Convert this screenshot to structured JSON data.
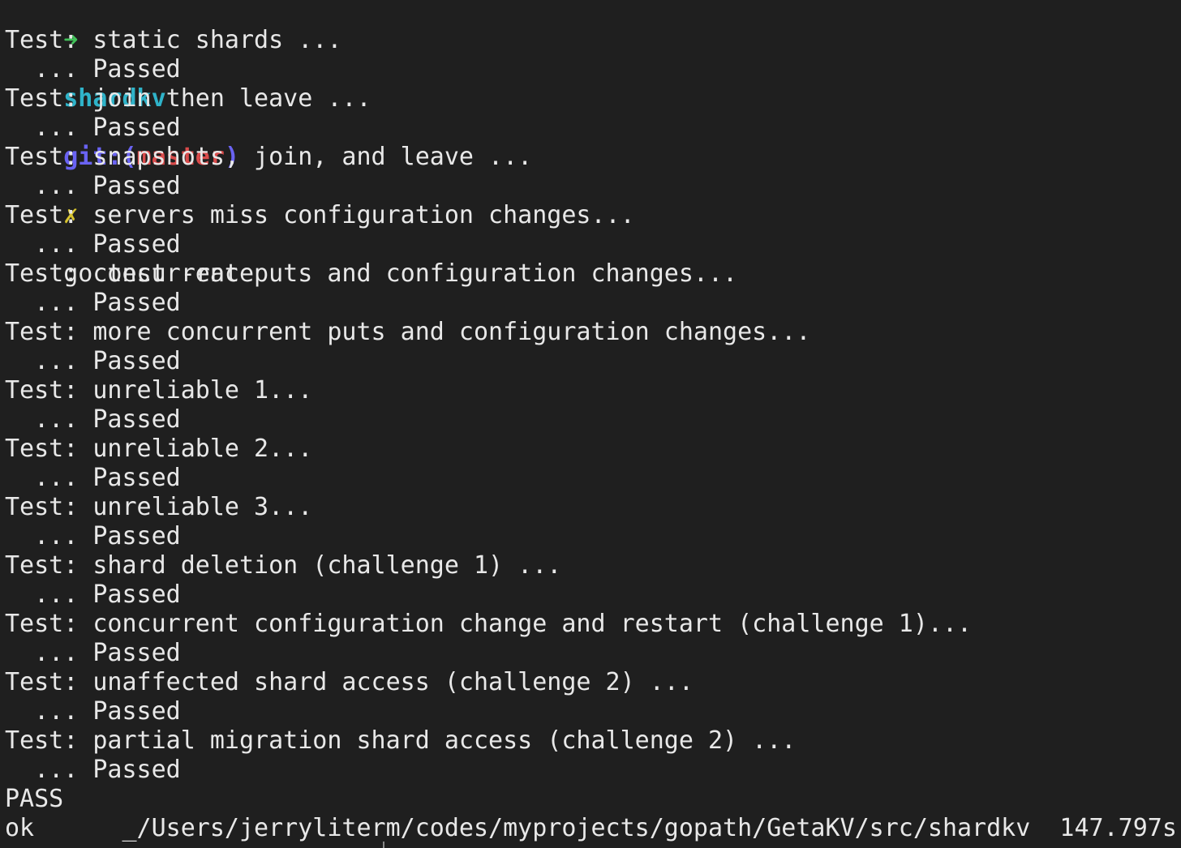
{
  "colors": {
    "background": "#1f1f1f",
    "text": "#e8e8e8",
    "prompt_arrow": "#42c25a",
    "prompt_dir": "#2fb3c9",
    "prompt_git": "#6a63f2",
    "prompt_branch": "#d94b4b",
    "prompt_dirty": "#d8c42f"
  },
  "prompt": {
    "arrow": "➜",
    "directory": "shardkv",
    "git_prefix": "git:(",
    "branch": "master",
    "git_suffix": ")",
    "dirty_marker": "✗",
    "command": "go test -race"
  },
  "output": [
    "Test: static shards ...",
    "  ... Passed",
    "Test: join then leave ...",
    "  ... Passed",
    "Test: snapshots, join, and leave ...",
    "  ... Passed",
    "Test: servers miss configuration changes...",
    "  ... Passed",
    "Test: concurrent puts and configuration changes...",
    "  ... Passed",
    "Test: more concurrent puts and configuration changes...",
    "  ... Passed",
    "Test: unreliable 1...",
    "  ... Passed",
    "Test: unreliable 2...",
    "  ... Passed",
    "Test: unreliable 3...",
    "  ... Passed",
    "Test: shard deletion (challenge 1) ...",
    "  ... Passed",
    "Test: concurrent configuration change and restart (challenge 1)...",
    "  ... Passed",
    "Test: unaffected shard access (challenge 2) ...",
    "  ... Passed",
    "Test: partial migration shard access (challenge 2) ...",
    "  ... Passed",
    "PASS",
    "ok      _/Users/jerryliterm/codes/myprojects/gopath/GetaKV/src/shardkv  147.797s"
  ]
}
